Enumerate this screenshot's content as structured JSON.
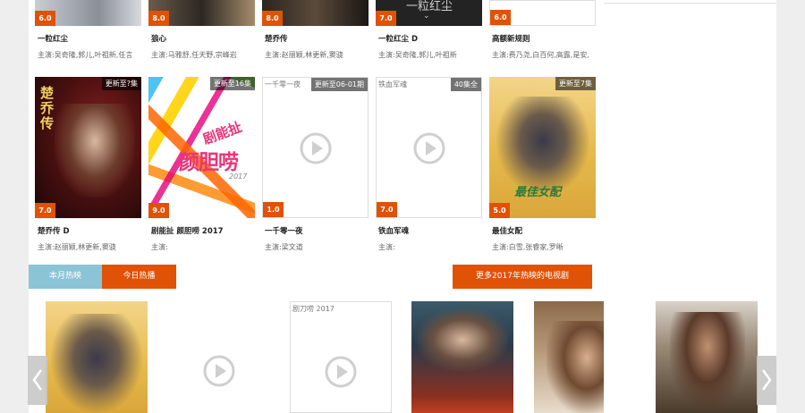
{
  "row1": [
    {
      "score": "6.0",
      "title": "一粒红尘",
      "cast": "主演:吴奇隆,郭儿,叶祖新,任言"
    },
    {
      "score": "8.0",
      "title": "狼心",
      "cast": "主演:马雅舒,任天野,宗峰岩"
    },
    {
      "score": "8.0",
      "title": "楚乔传",
      "cast": "主演:赵丽颖,林更新,窦骁"
    },
    {
      "score": "7.0",
      "title": "一粒红尘 D",
      "cast": "主演:吴奇隆,郭儿,叶祖新"
    },
    {
      "score": "6.0",
      "title": "高额新规则",
      "cast": "主演:费乃尧,白百何,高露,是安,"
    }
  ],
  "row1_poster_text": "一粒红尘",
  "row2": [
    {
      "score": "7.0",
      "update": "更新至?集",
      "title": "楚乔传 D",
      "cast": "主演:赵丽颖,林更新,窦骁",
      "alt": ""
    },
    {
      "score": "9.0",
      "update": "更新至16集",
      "title": "剧能扯 颜胆唠 2017",
      "cast": "主演:",
      "alt": ""
    },
    {
      "score": "1.0",
      "update": "更新至06-01期",
      "title": "一千零一夜",
      "cast": "主演:梁文道",
      "alt": "一千零一夜"
    },
    {
      "score": "7.0",
      "update": "40集全",
      "title": "铁血军魂",
      "cast": "主演:",
      "alt": "铁血军魂"
    },
    {
      "score": "5.0",
      "update": "更新至7集",
      "title": "最佳女配",
      "cast": "主演:白雪,张睿家,罗晰",
      "alt": ""
    }
  ],
  "poster_text": {
    "chuqiao": "楚乔传",
    "juneng_top": "剧能扯",
    "juneng_main": "颜胆唠",
    "juneng_year": "2017",
    "zuijia": "最佳女配"
  },
  "tabs": {
    "month": "本月热映",
    "today": "今日热播",
    "more": "更多2017年热映的电视剧"
  },
  "row3_alt": "剧刀唠 2017",
  "colors": {
    "accent": "#e05206",
    "tab_inactive": "#8bc4d6",
    "score": "#e05206"
  },
  "icons": {
    "play": "play-circle-icon",
    "prev": "chevron-left-icon",
    "next": "chevron-right-icon"
  }
}
